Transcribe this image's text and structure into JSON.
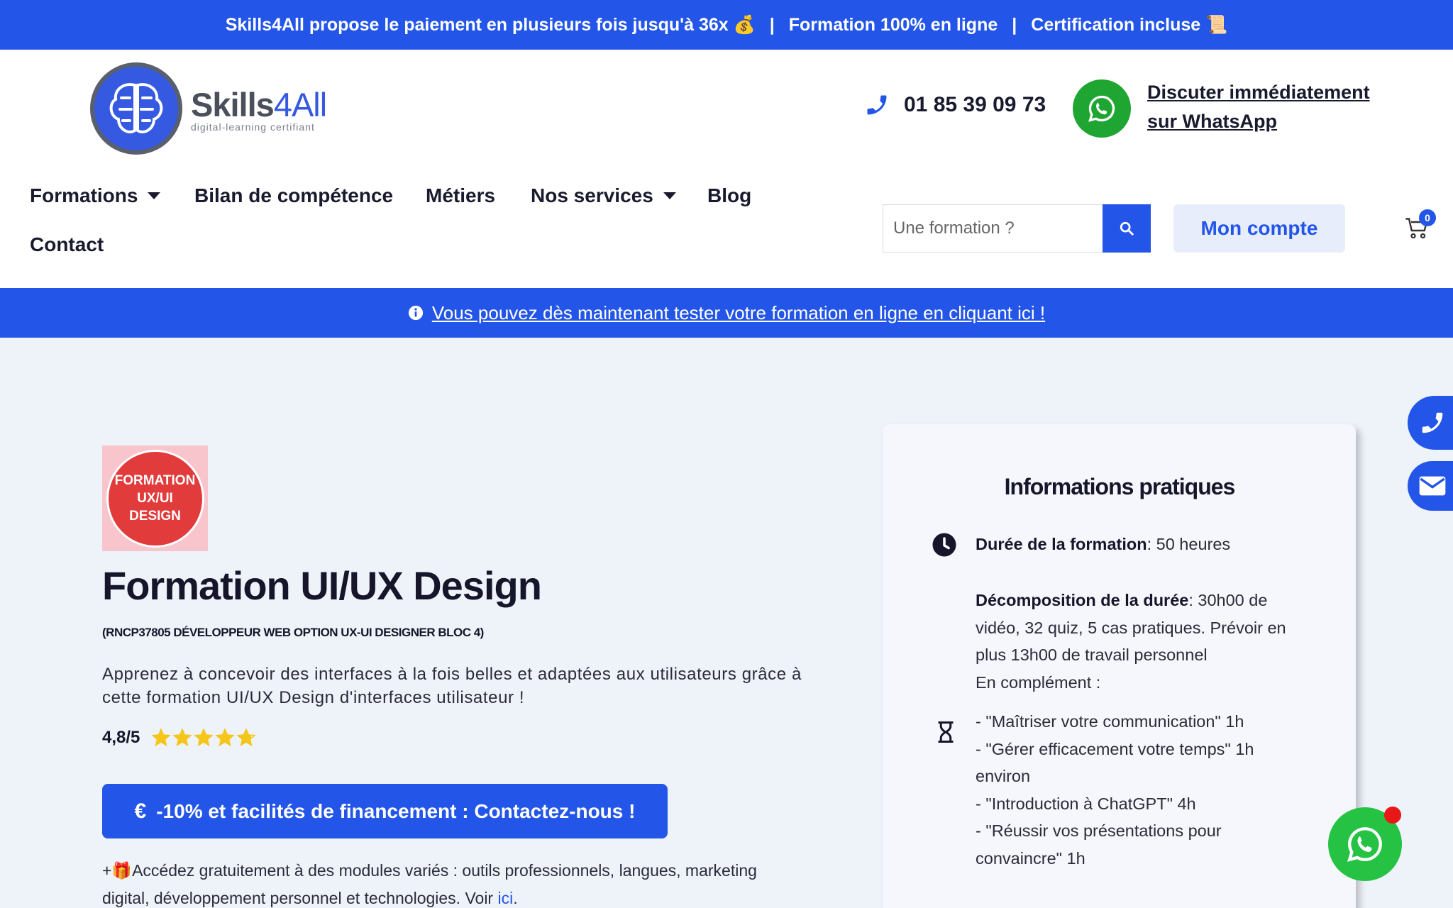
{
  "topbar": {
    "msg1": "Skills4All propose le paiement en plusieurs fois jusqu'à 36x 💰",
    "msg2": "Formation 100% en ligne",
    "msg3": "Certification incluse 📜",
    "separator": "|"
  },
  "logo": {
    "name_part1": "Skills",
    "name_part2": "4All",
    "tagline": "digital-learning certifiant"
  },
  "contact": {
    "phone": "01 85 39 09 73",
    "whatsapp_line1": "Discuter immédiatement",
    "whatsapp_line2": "sur WhatsApp"
  },
  "nav": {
    "items": [
      {
        "label": "Formations",
        "has_caret": true
      },
      {
        "label": "Bilan de compétence",
        "has_caret": false
      },
      {
        "label": "Métiers",
        "has_caret": false
      },
      {
        "label": "Nos services",
        "has_caret": true
      },
      {
        "label": "Blog",
        "has_caret": false
      },
      {
        "label": "Contact",
        "has_caret": false
      }
    ]
  },
  "search": {
    "placeholder": "Une formation ?"
  },
  "account": {
    "label": "Mon compte"
  },
  "cart": {
    "count": "0"
  },
  "infobar": {
    "text": "Vous pouvez dès maintenant tester votre formation en ligne en cliquant ici !"
  },
  "course": {
    "badge_line1": "FORMATION",
    "badge_line2": "UX/UI",
    "badge_line3": "DESIGN",
    "title": "Formation UI/UX Design",
    "subtitle": "(RNCP37805 DÉVELOPPEUR WEB OPTION UX-UI DESIGNER BLOC 4)",
    "description": "Apprenez à concevoir des interfaces à la fois belles et adaptées aux utilisateurs grâce à cette formation UI/UX Design d'interfaces utilisateur !",
    "rating_text": "4,8/5",
    "rating_value": 4.8,
    "rating_max": 5,
    "cta": "-10% et facilités de financement : Contactez-nous !",
    "cta_symbol": "€",
    "modules_text": "+🎁Accédez gratuitement à des modules variés : outils professionnels, langues, marketing digital, développement personnel et technologies. Voir",
    "modules_link": "ici",
    "modules_end": "."
  },
  "info_card": {
    "title": "Informations pratiques",
    "duration_label": "Durée de la formation",
    "duration_value": ": 50 heures",
    "breakdown_label": "Décomposition de la durée",
    "breakdown_value": ": 30h00 de vidéo, 32 quiz, 5 cas pratiques. Prévoir en plus 13h00 de travail personnel",
    "complement_label": "En complément :",
    "complements": [
      "- \"Maîtriser votre communication\" 1h",
      "- \"Gérer efficacement votre temps\" 1h environ",
      "- \"Introduction à ChatGPT\" 4h",
      "- \"Réussir vos présentations pour convaincre\" 1h"
    ]
  },
  "colors": {
    "brand_blue": "#2356e8",
    "whatsapp_green": "#25c244",
    "badge_red": "#e13b3b",
    "star_yellow": "#f5c518"
  }
}
